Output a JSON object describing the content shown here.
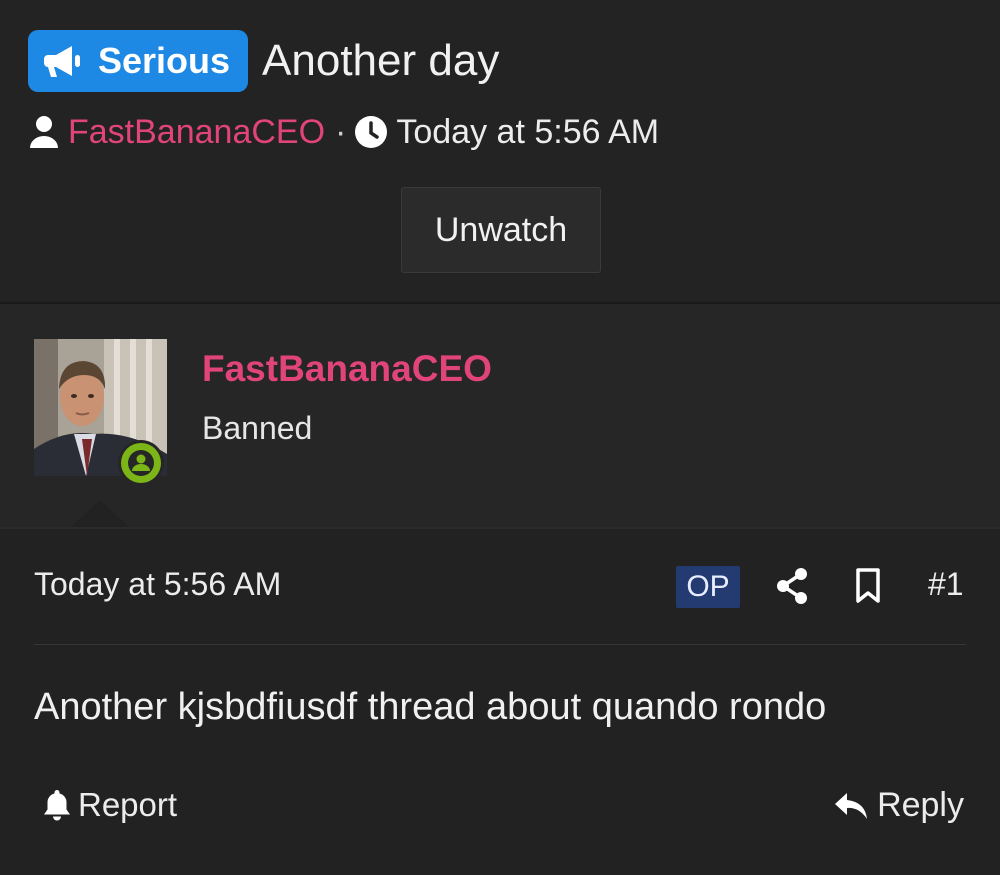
{
  "thread": {
    "prefix_label": "Serious",
    "prefix_icon": "megaphone-icon",
    "prefix_color": "#1e88e5",
    "title": "Another day",
    "author": "FastBananaCEO",
    "separator": "·",
    "date": "Today at 5:56 AM",
    "watch_button_label": "Unwatch"
  },
  "post": {
    "username": "FastBananaCEO",
    "user_title": "Banned",
    "username_color": "#e0447a",
    "date": "Today at 5:56 AM",
    "op_label": "OP",
    "post_number": "#1",
    "message": "Another kjsbdfiusdf thread about quando rondo",
    "report_label": "Report",
    "reply_label": "Reply"
  }
}
